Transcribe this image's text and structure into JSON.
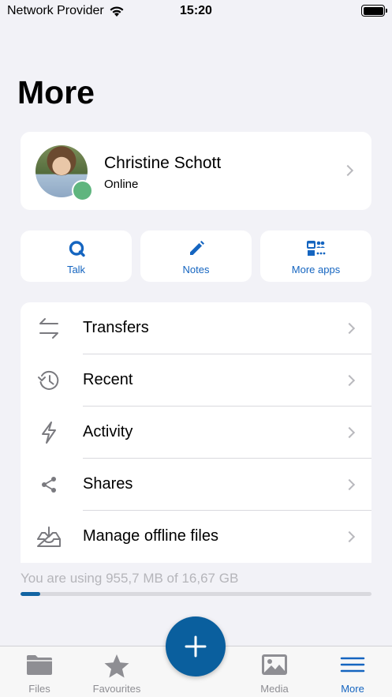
{
  "status_bar": {
    "carrier": "Network Provider",
    "time": "15:20"
  },
  "page": {
    "title": "More"
  },
  "profile": {
    "name": "Christine Schott",
    "status": "Online"
  },
  "apps": [
    {
      "label": "Talk",
      "icon": "talk-icon"
    },
    {
      "label": "Notes",
      "icon": "pencil-icon"
    },
    {
      "label": "More apps",
      "icon": "apps-grid-icon"
    }
  ],
  "menu": [
    {
      "label": "Transfers",
      "icon": "transfer-arrows-icon"
    },
    {
      "label": "Recent",
      "icon": "history-icon"
    },
    {
      "label": "Activity",
      "icon": "lightning-icon"
    },
    {
      "label": "Shares",
      "icon": "share-icon"
    },
    {
      "label": "Manage offline files",
      "icon": "tray-download-icon"
    }
  ],
  "storage": {
    "text": "You are using 955,7 MB of 16,67 GB",
    "used_fraction": 0.057
  },
  "tabs": [
    {
      "label": "Files",
      "icon": "folder-icon"
    },
    {
      "label": "Favourites",
      "icon": "star-icon"
    },
    {
      "label": "Media",
      "icon": "image-icon"
    },
    {
      "label": "More",
      "icon": "menu-lines-icon"
    }
  ],
  "colors": {
    "accent": "#1565c0",
    "fab": "#0a5f9e",
    "online": "#5fb57e",
    "background": "#f2f2f7"
  }
}
